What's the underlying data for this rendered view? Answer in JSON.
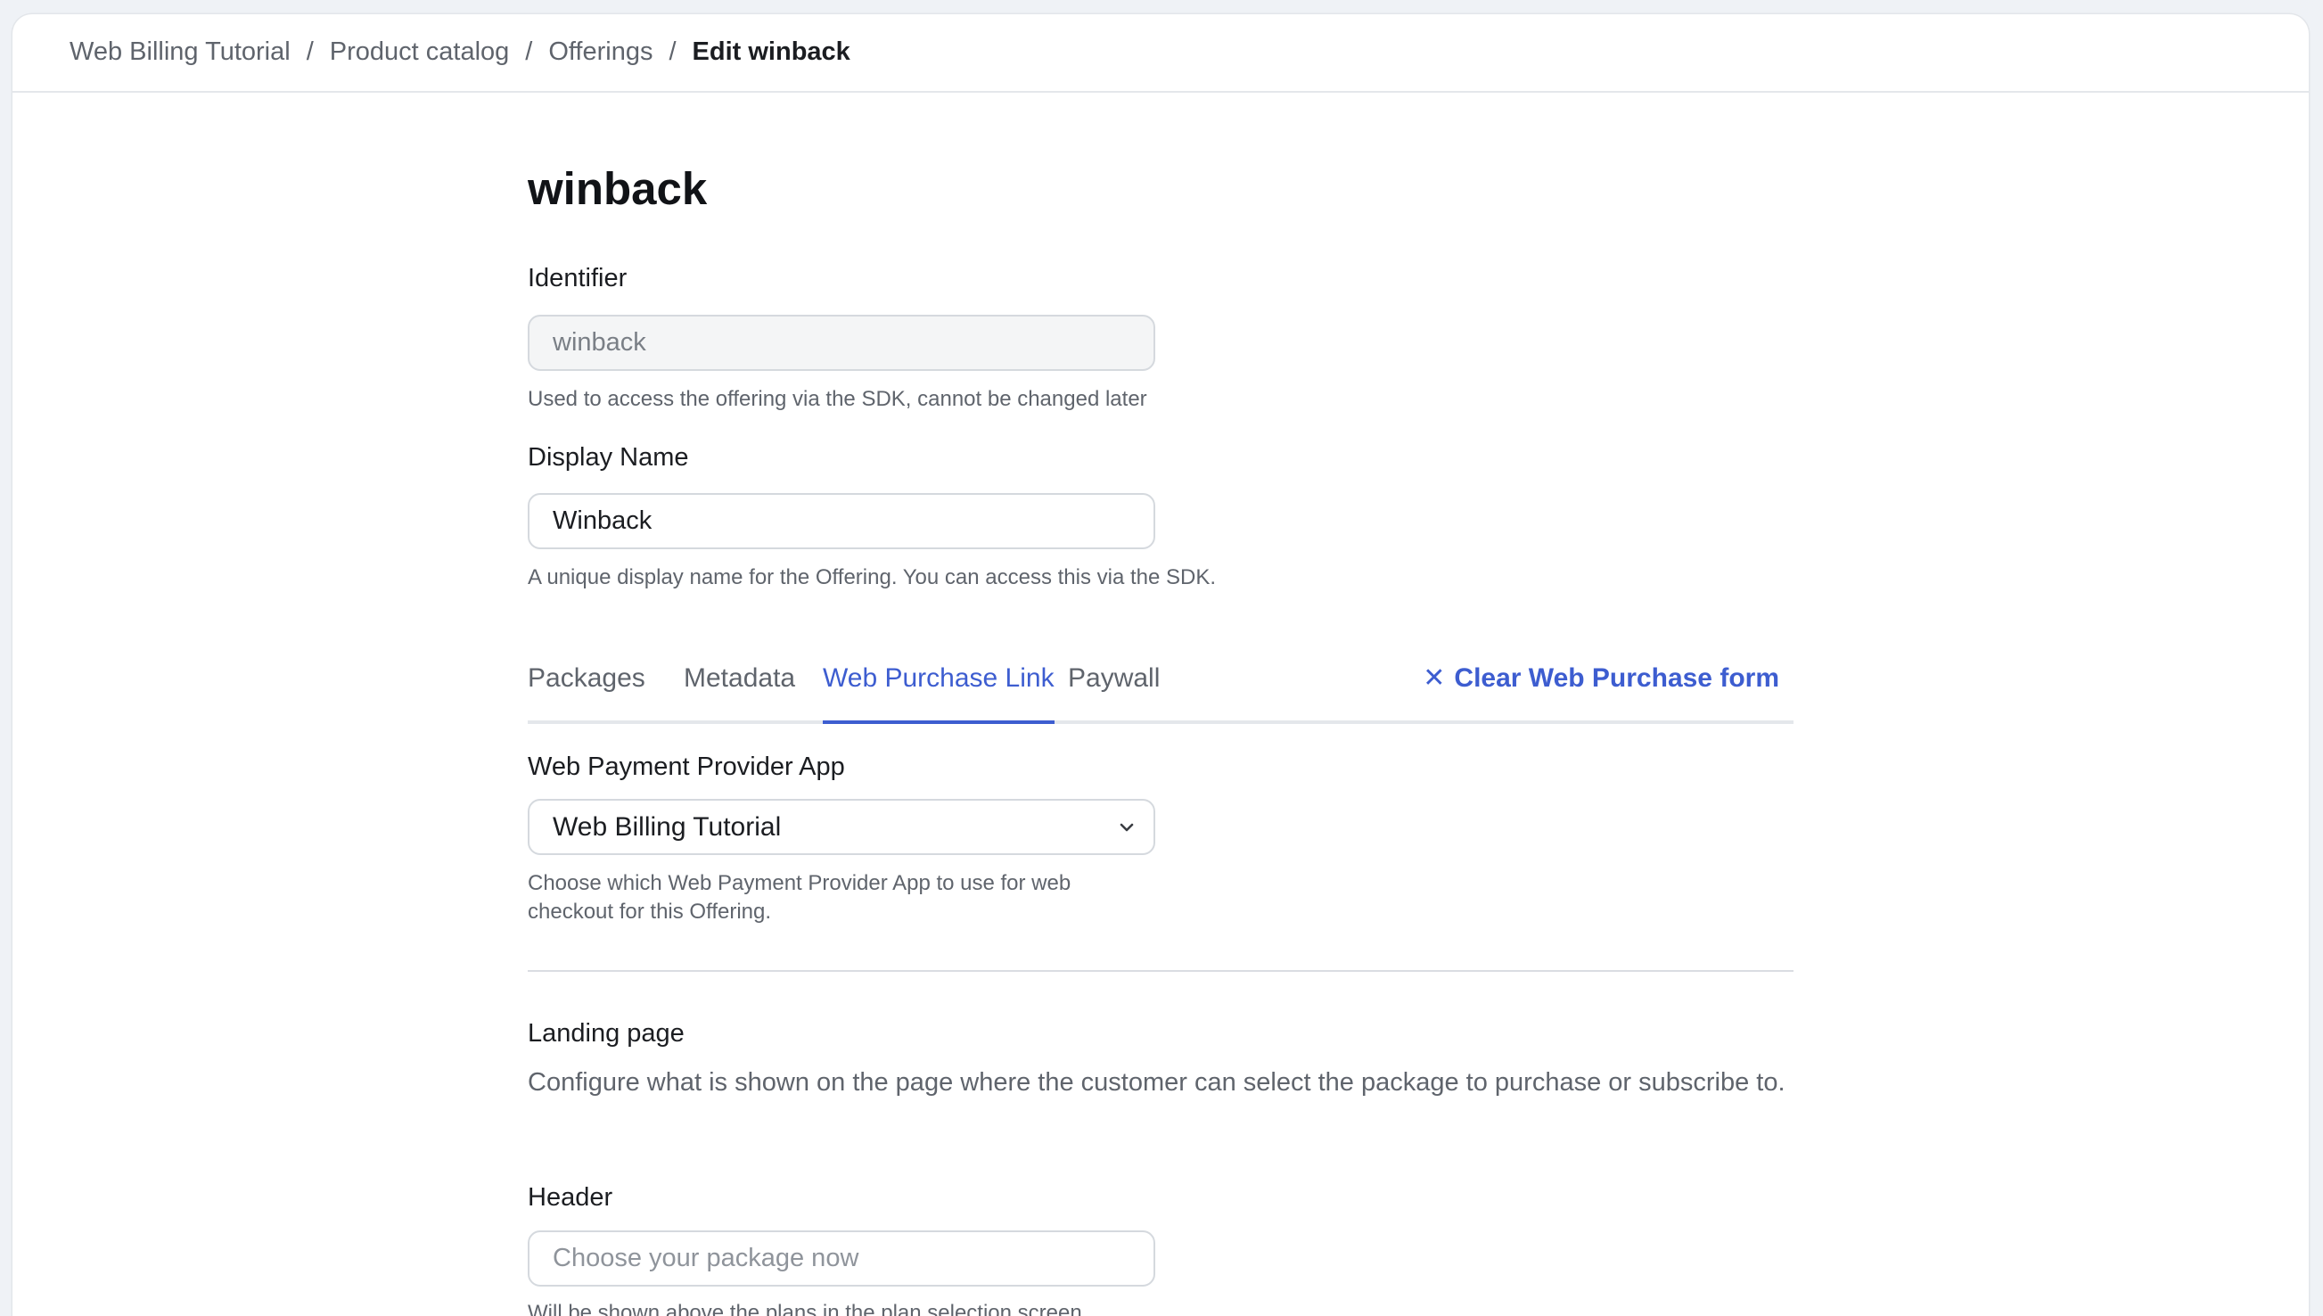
{
  "breadcrumb": {
    "items": [
      "Web Billing Tutorial",
      "Product catalog",
      "Offerings"
    ],
    "separator": "/",
    "current": "Edit winback"
  },
  "page": {
    "title": "winback"
  },
  "identifier": {
    "label": "Identifier",
    "value": "winback",
    "help": "Used to access the offering via the SDK, cannot be changed later"
  },
  "display_name": {
    "label": "Display Name",
    "value": "Winback",
    "help": "A unique display name for the Offering. You can access this via the SDK."
  },
  "tabs": {
    "items": [
      {
        "label": "Packages"
      },
      {
        "label": "Metadata"
      },
      {
        "label": "Web Purchase Link"
      },
      {
        "label": "Paywall"
      }
    ],
    "active": "Web Purchase Link",
    "clear_label": "Clear Web Purchase form",
    "clear_icon": "x-icon"
  },
  "provider": {
    "label": "Web Payment Provider App",
    "selected": "Web Billing Tutorial",
    "help_line1": "Choose which Web Payment Provider App to use for web",
    "help_line2": "checkout for this Offering."
  },
  "landing": {
    "title": "Landing page",
    "description": "Configure what is shown on the page where the customer can select the package to purchase or subscribe to."
  },
  "header_field": {
    "label": "Header",
    "placeholder": "Choose your package now",
    "help": "Will be shown above the plans in the plan selection screen"
  },
  "colors": {
    "accent": "#3d5dd0",
    "text": "#1b1d21",
    "muted": "#5f646c",
    "background": "#eff2f6"
  }
}
